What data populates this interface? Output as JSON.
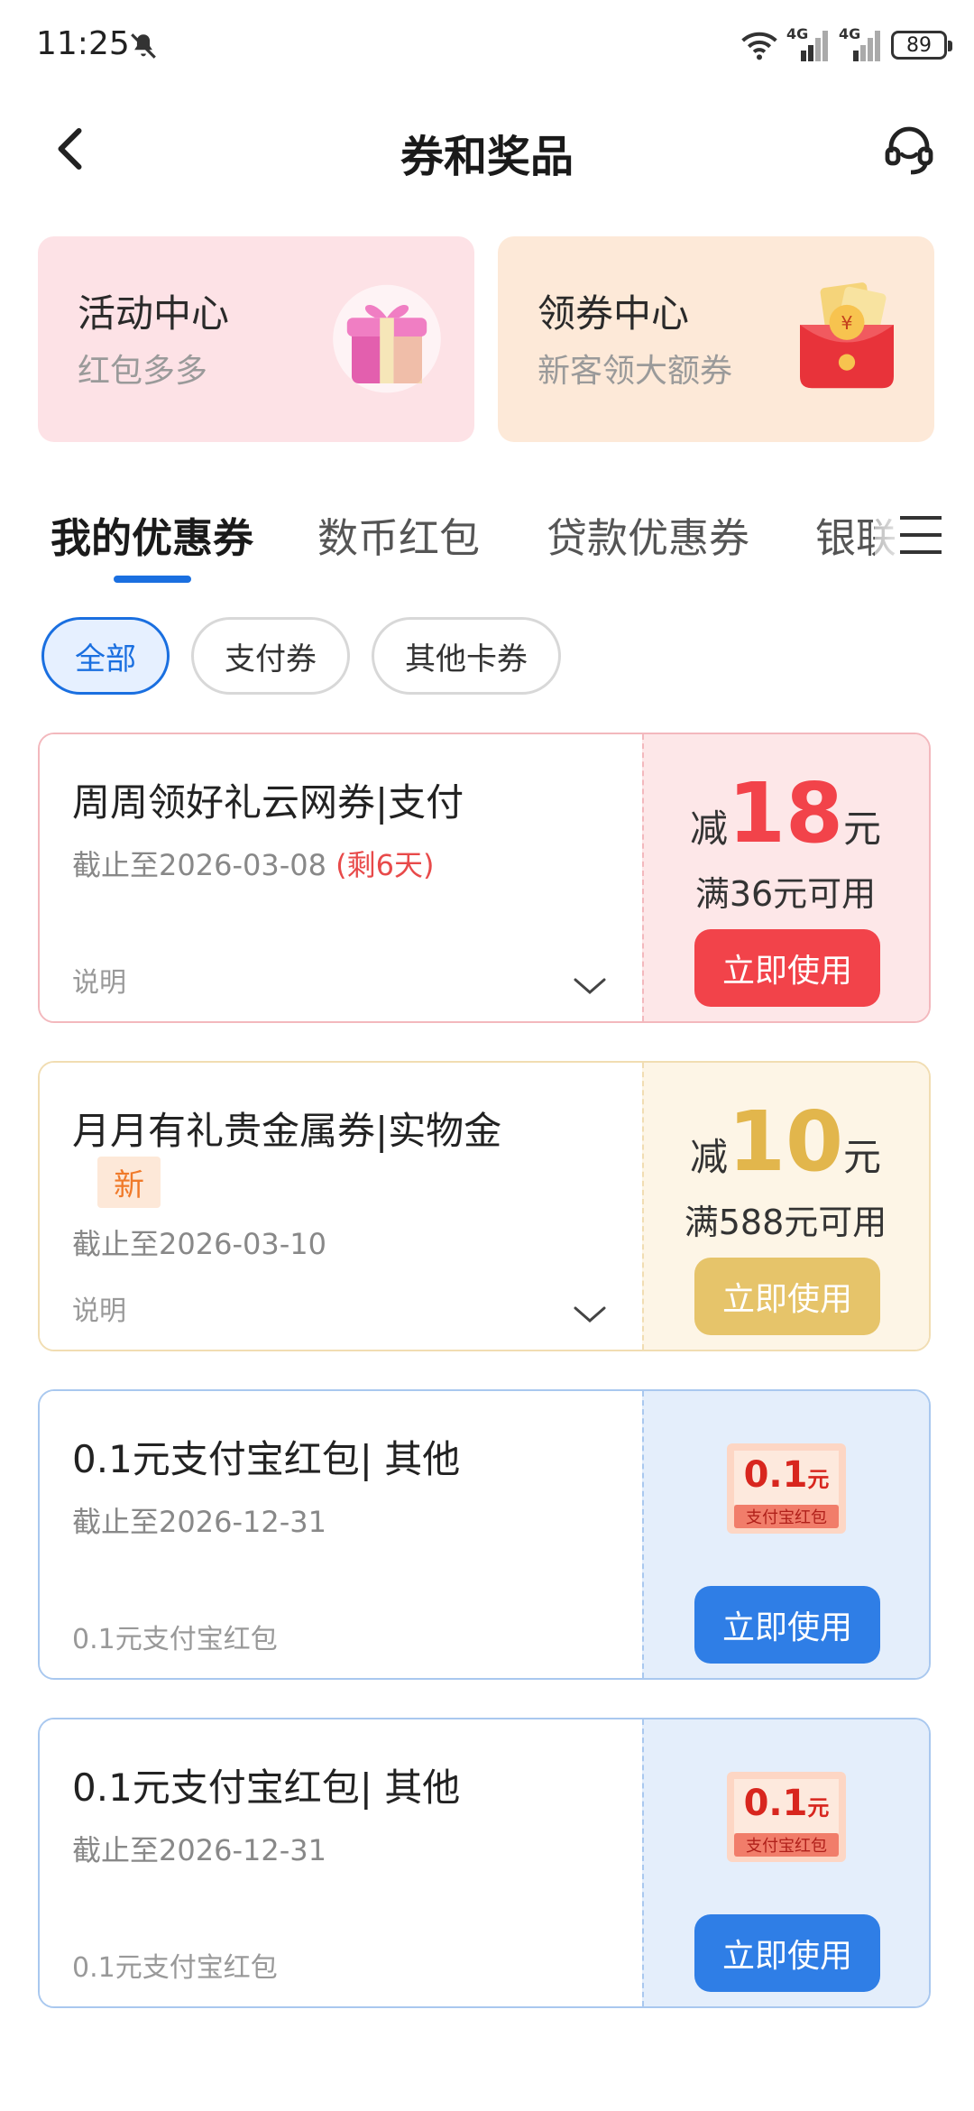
{
  "status_bar": {
    "time": "11:25",
    "battery": "89",
    "network_1": "4G",
    "network_2": "4G"
  },
  "header": {
    "title": "券和奖品"
  },
  "top_cards": [
    {
      "title": "活动中心",
      "subtitle": "红包多多",
      "icon": "gift-box-icon"
    },
    {
      "title": "领券中心",
      "subtitle": "新客领大额券",
      "icon": "red-envelope-icon"
    }
  ],
  "tabs": [
    {
      "label": "我的优惠券",
      "active": true
    },
    {
      "label": "数币红包",
      "active": false
    },
    {
      "label": "贷款优惠券",
      "active": false
    },
    {
      "label": "银联",
      "active": false
    }
  ],
  "filters": [
    {
      "label": "全部",
      "active": true
    },
    {
      "label": "支付券",
      "active": false
    },
    {
      "label": "其他卡券",
      "active": false
    }
  ],
  "coupons": [
    {
      "title": "周周领好礼云网券|支付",
      "date": "截止至2026-03-08",
      "remain": "(剩6天)",
      "note": "说明",
      "prefix": "减",
      "amount": "18",
      "unit": "元",
      "condition": "满36元可用",
      "button": "立即使用",
      "theme": {
        "border": "#f3b8bd",
        "bg": "#fde7e8",
        "accent": "#f2434a",
        "button": "#f2434a"
      }
    },
    {
      "title": "月月有礼贵金属券|实物金",
      "badge": "新",
      "date": "截止至2026-03-10",
      "note": "说明",
      "prefix": "减",
      "amount": "10",
      "unit": "元",
      "condition": "满588元可用",
      "button": "立即使用",
      "theme": {
        "border": "#f1ddb2",
        "bg": "#fdf5e6",
        "accent": "#e2b64c",
        "button": "#e6c46a"
      }
    },
    {
      "title": "0.1元支付宝红包| 其他",
      "date": "截止至2026-12-31",
      "note": "0.1元支付宝红包",
      "badge_value": "0.1",
      "badge_unit": "元",
      "badge_label": "支付宝红包",
      "button": "立即使用",
      "theme": {
        "border": "#a9c8ef",
        "bg": "#e4eefb",
        "button": "#2f7ee6"
      }
    },
    {
      "title": "0.1元支付宝红包| 其他",
      "date": "截止至2026-12-31",
      "note": "0.1元支付宝红包",
      "badge_value": "0.1",
      "badge_unit": "元",
      "badge_label": "支付宝红包",
      "button": "立即使用",
      "theme": {
        "border": "#a9c8ef",
        "bg": "#e4eefb",
        "button": "#2f7ee6"
      }
    }
  ]
}
